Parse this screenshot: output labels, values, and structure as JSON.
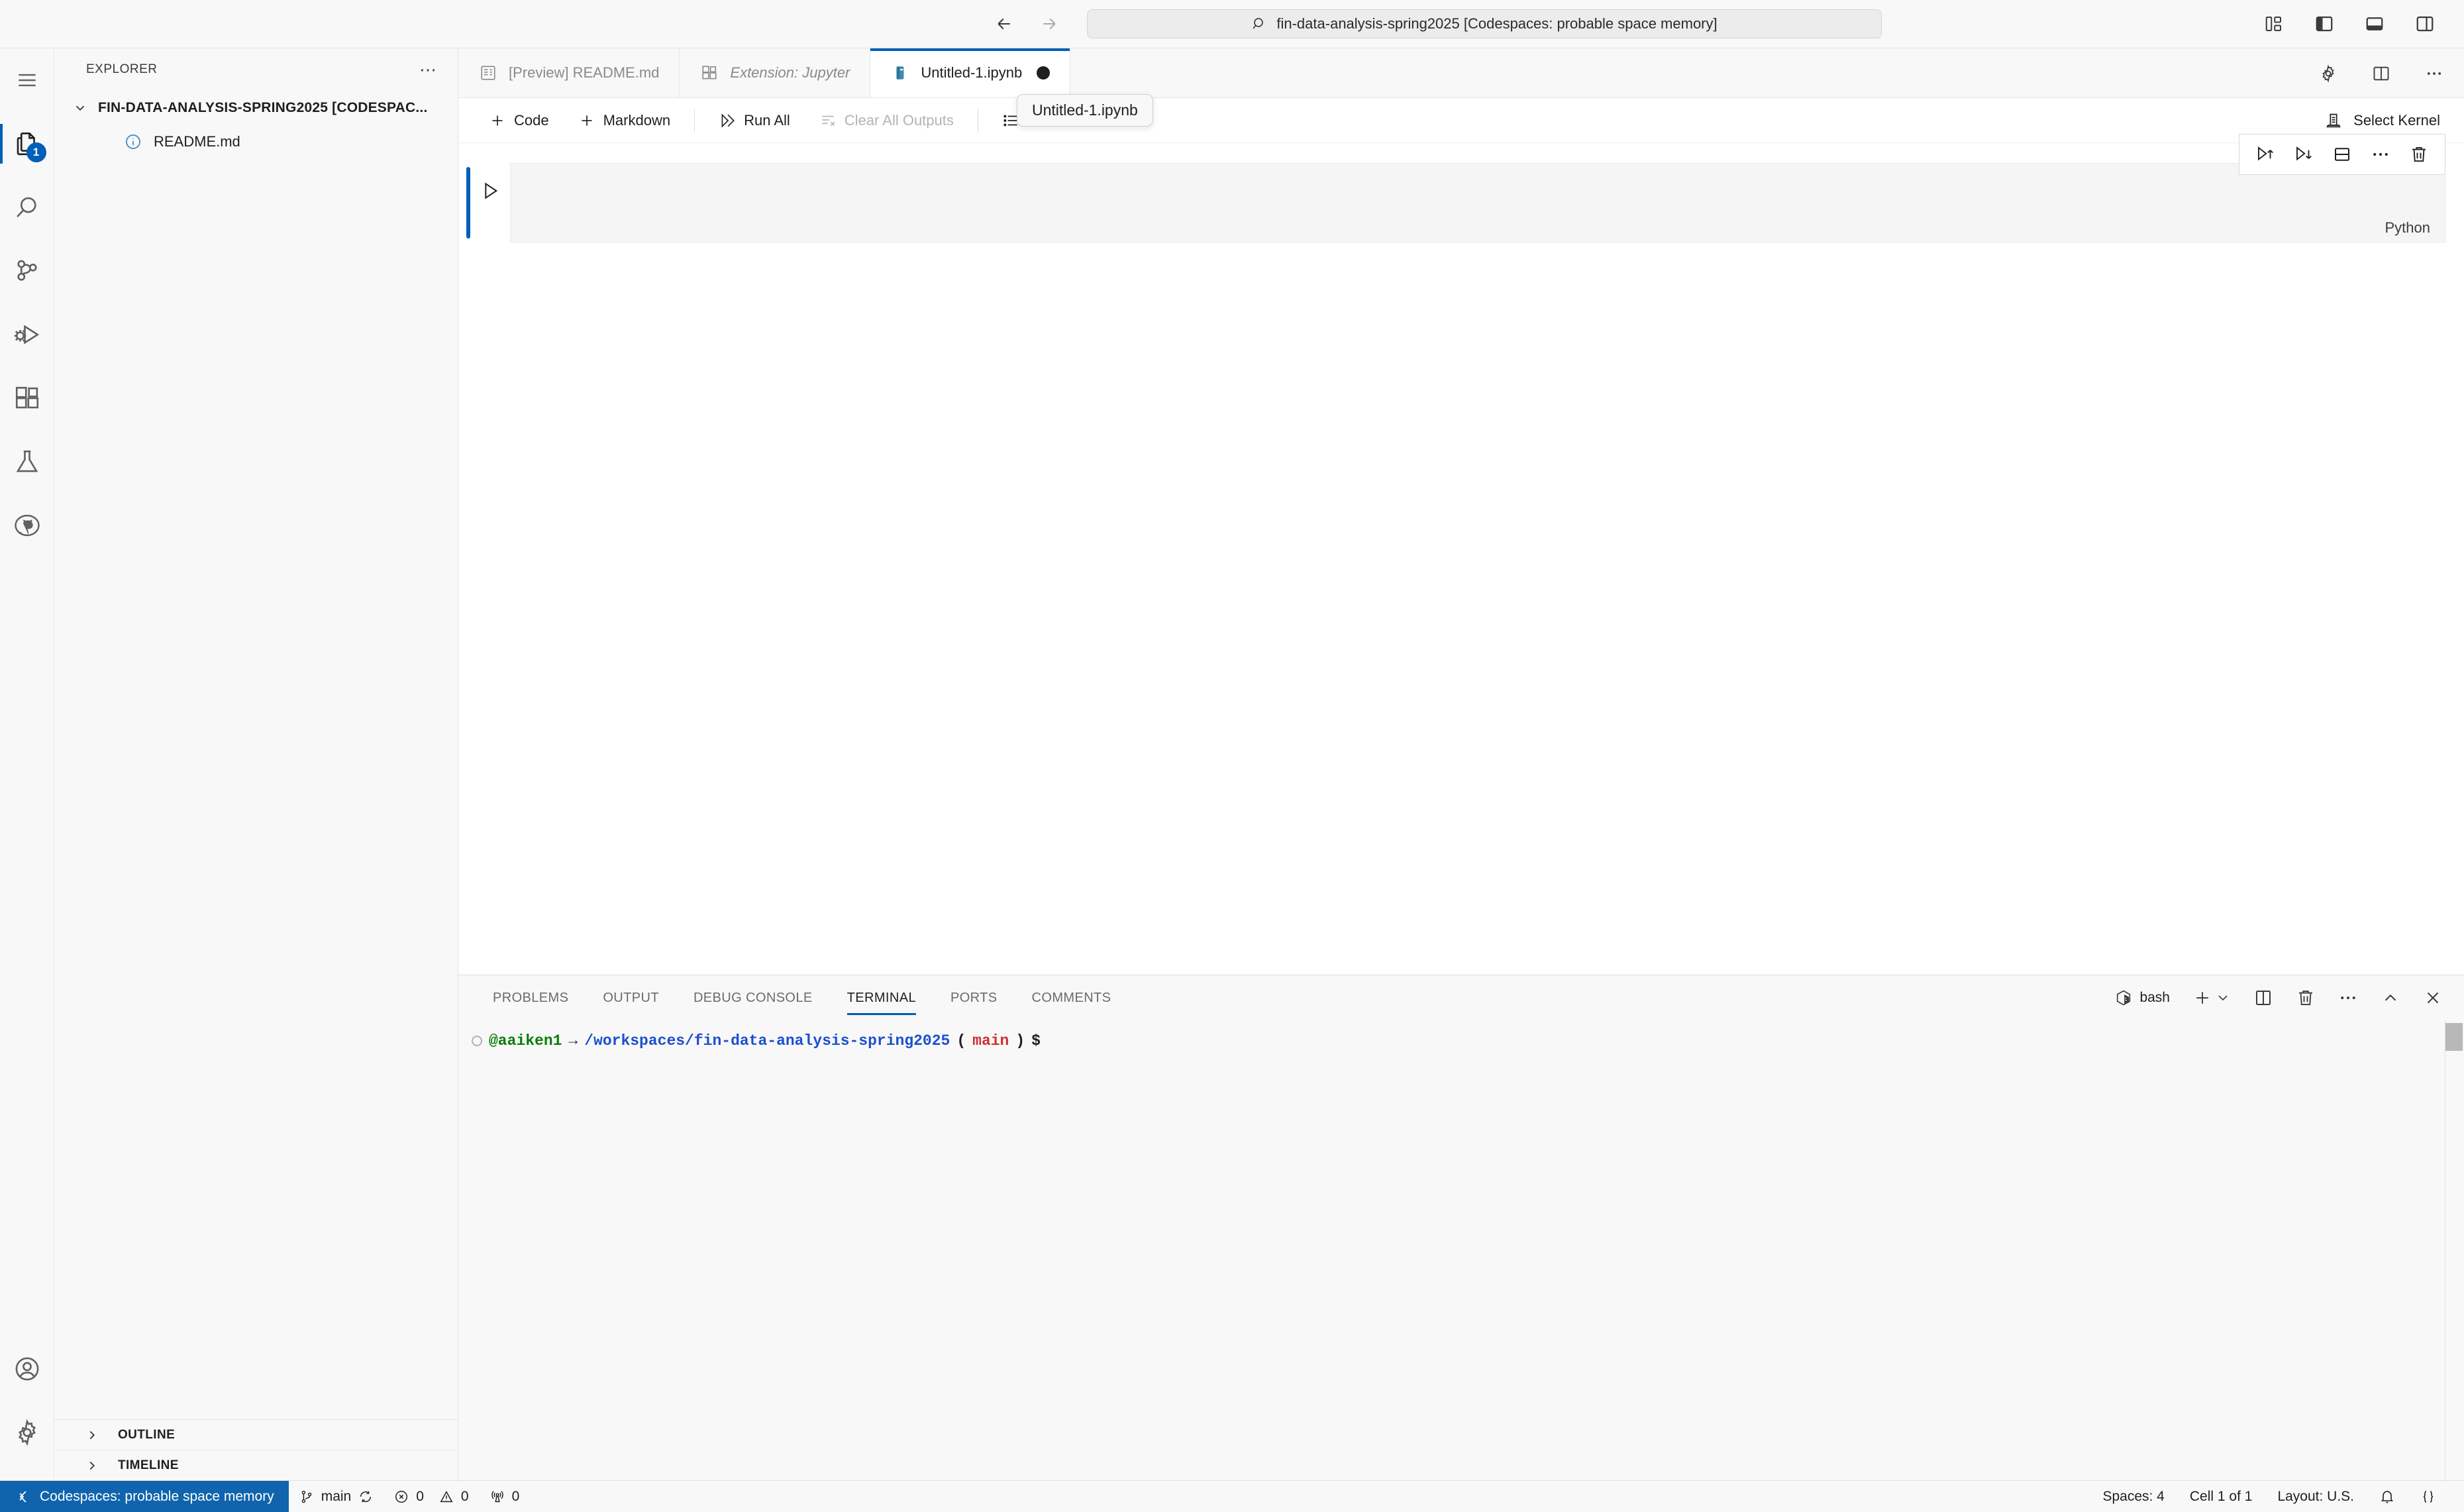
{
  "titlebar": {
    "back_icon": "arrow-left-icon",
    "forward_icon": "arrow-right-icon",
    "search_icon": "search-icon",
    "command_center_text": "fin-data-analysis-spring2025 [Codespaces: probable space memory]",
    "layout_buttons": [
      {
        "name": "customize-layout-icon",
        "label": "Customize Layout"
      },
      {
        "name": "toggle-primary-sidebar-icon",
        "label": "Toggle Primary Side Bar"
      },
      {
        "name": "toggle-panel-icon",
        "label": "Toggle Panel"
      },
      {
        "name": "toggle-secondary-sidebar-icon",
        "label": "Toggle Secondary Side Bar"
      }
    ]
  },
  "activitybar": {
    "menu": {
      "icon": "hamburger-menu-icon",
      "label": "Menu"
    },
    "items": [
      {
        "icon": "files-icon",
        "label": "Explorer",
        "badge": "1",
        "active": true
      },
      {
        "icon": "search-icon",
        "label": "Search",
        "badge": "",
        "active": false
      },
      {
        "icon": "source-control-icon",
        "label": "Source Control",
        "badge": "",
        "active": false
      },
      {
        "icon": "run-and-debug-icon",
        "label": "Run and Debug",
        "badge": "",
        "active": false
      },
      {
        "icon": "extensions-icon",
        "label": "Extensions",
        "badge": "",
        "active": false
      },
      {
        "icon": "testing-icon",
        "label": "Testing",
        "badge": "",
        "active": false
      },
      {
        "icon": "github-icon",
        "label": "GitHub",
        "badge": "",
        "active": false
      }
    ],
    "bottom": [
      {
        "icon": "account-icon",
        "label": "Accounts"
      },
      {
        "icon": "gear-icon",
        "label": "Manage"
      }
    ]
  },
  "sidebar": {
    "title": "EXPLORER",
    "more_icon": "ellipsis-icon",
    "root": {
      "chevron": "chevron-down-icon",
      "label": "FIN-DATA-ANALYSIS-SPRING2025 [CODESPAC..."
    },
    "files": [
      {
        "icon": "markdown-info-icon",
        "name": "README.md"
      }
    ],
    "sections": [
      {
        "chevron": "chevron-right-icon",
        "label": "OUTLINE"
      },
      {
        "chevron": "chevron-right-icon",
        "label": "TIMELINE"
      }
    ]
  },
  "editor": {
    "tabs": [
      {
        "icon": "preview-icon",
        "label": "[Preview] README.md",
        "active": false,
        "italic": false,
        "dirty": false
      },
      {
        "icon": "extension-icon",
        "label": "Extension: Jupyter",
        "active": false,
        "italic": true,
        "dirty": false
      },
      {
        "icon": "notebook-icon",
        "label": "Untitled-1.ipynb",
        "active": true,
        "italic": false,
        "dirty": true
      }
    ],
    "tab_actions": [
      {
        "icon": "gear-icon",
        "label": "Settings"
      },
      {
        "icon": "split-editor-icon",
        "label": "Split Editor"
      },
      {
        "icon": "ellipsis-icon",
        "label": "More Actions"
      }
    ],
    "notebook_toolbar": {
      "add_code": {
        "icon": "plus-icon",
        "label": "Code"
      },
      "add_markdown": {
        "icon": "plus-icon",
        "label": "Markdown"
      },
      "run_all": {
        "icon": "run-all-icon",
        "label": "Run All"
      },
      "clear_outputs": {
        "icon": "clear-outputs-icon",
        "label": "Clear All Outputs",
        "disabled": true
      },
      "outline": {
        "icon": "outline-icon",
        "label": "Outline"
      },
      "kernel": {
        "icon": "kernel-icon",
        "label": "Select Kernel"
      }
    },
    "tooltip": "Untitled-1.ipynb",
    "cell": {
      "run_icon": "play-icon",
      "language": "Python",
      "content": "",
      "toolbar": [
        {
          "icon": "run-above-icon",
          "label": "Execute Above Cells"
        },
        {
          "icon": "run-below-icon",
          "label": "Execute Cell and Below"
        },
        {
          "icon": "split-cell-icon",
          "label": "Split Cell"
        },
        {
          "icon": "more-actions-icon",
          "label": "More Actions"
        },
        {
          "icon": "trash-icon",
          "label": "Delete Cell"
        }
      ]
    }
  },
  "panel": {
    "tabs": [
      {
        "label": "PROBLEMS",
        "active": false
      },
      {
        "label": "OUTPUT",
        "active": false
      },
      {
        "label": "DEBUG CONSOLE",
        "active": false
      },
      {
        "label": "TERMINAL",
        "active": true
      },
      {
        "label": "PORTS",
        "active": false
      },
      {
        "label": "COMMENTS",
        "active": false
      }
    ],
    "actions": {
      "shell_icon": "bash-icon",
      "shell_label": "bash",
      "new_terminal": {
        "icon": "plus-icon",
        "label": "New Terminal"
      },
      "new_terminal_dropdown": {
        "icon": "chevron-down-icon",
        "label": "Launch Profile"
      },
      "split": {
        "icon": "split-terminal-icon",
        "label": "Split Terminal"
      },
      "kill": {
        "icon": "trash-icon",
        "label": "Kill Terminal"
      },
      "more": {
        "icon": "ellipsis-icon",
        "label": "Views and More Actions"
      },
      "maximize": {
        "icon": "chevron-up-icon",
        "label": "Maximize Panel Size"
      },
      "close": {
        "icon": "close-icon",
        "label": "Close Panel"
      }
    },
    "terminal": {
      "user": "@aaiken1",
      "arrow": "→",
      "path": "/workspaces/fin-data-analysis-spring2025",
      "branch_open": "(",
      "branch": "main",
      "branch_close": ")",
      "prompt": "$"
    }
  },
  "statusbar": {
    "remote": {
      "icon": "remote-icon",
      "label": "Codespaces: probable space memory"
    },
    "left_items": [
      {
        "icon": "git-branch-icon",
        "label": "main",
        "trailing_icon": "sync-icon"
      },
      {
        "icon": "error-icon",
        "label": "0",
        "icon2": "warning-icon",
        "label2": "0"
      },
      {
        "icon": "radio-tower-icon",
        "label": "0"
      }
    ],
    "right_items": [
      {
        "label": "Spaces: 4"
      },
      {
        "label": "Cell 1 of 1"
      },
      {
        "label": "Layout: U.S."
      },
      {
        "icon": "bell-icon",
        "label": ""
      },
      {
        "icon": "braces-icon",
        "label": ""
      }
    ]
  },
  "colors": {
    "accent": "#005fb8",
    "remote_bg": "#0f64ad",
    "background": "#f8f8f8",
    "editor_bg": "#ffffff",
    "badge_bg": "#005fb8"
  }
}
